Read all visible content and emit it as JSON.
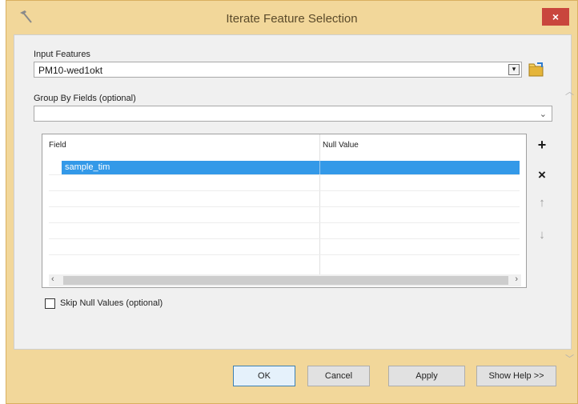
{
  "window": {
    "title": "Iterate Feature Selection",
    "close_glyph": "×"
  },
  "input_features": {
    "label": "Input Features",
    "value": "PM10-wed1okt",
    "dropdown_glyph": "▾"
  },
  "group_by": {
    "label": "Group By Fields (optional)",
    "value": "",
    "chevron_glyph": "⌄"
  },
  "table": {
    "columns": [
      "Field",
      "Null Value"
    ],
    "rows": [
      {
        "field": "sample_tim",
        "null_value": ""
      }
    ],
    "scroll_left": "‹",
    "scroll_right": "›"
  },
  "side_buttons": {
    "add": "+",
    "remove": "×",
    "move_up": "↑",
    "move_down": "↓"
  },
  "skip_null": {
    "label": "Skip Null Values (optional)",
    "checked": false
  },
  "buttons": {
    "ok": "OK",
    "cancel": "Cancel",
    "apply": "Apply",
    "show_help": "Show Help >>"
  },
  "colors": {
    "title_bar": "#f2d79a",
    "selection": "#3399e8",
    "close": "#c9463d"
  }
}
